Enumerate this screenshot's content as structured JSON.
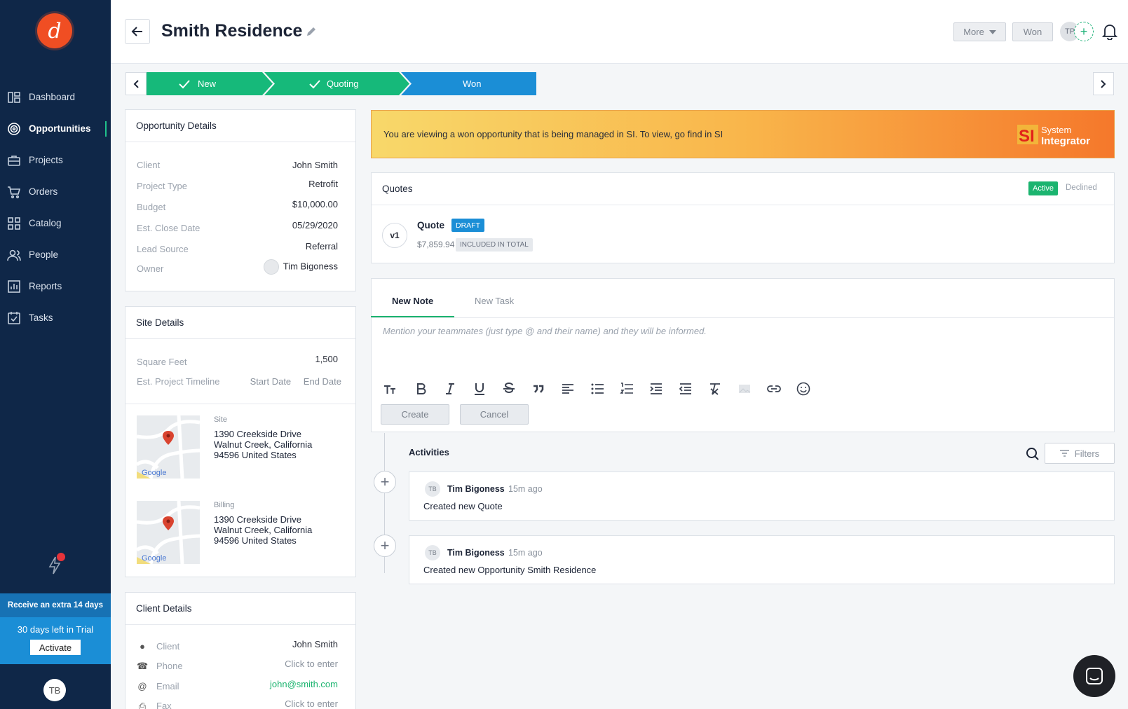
{
  "app": {
    "logo_letter": "d",
    "accent": "#f04e23",
    "sidebar_bg": "#0f2748"
  },
  "sidebar": {
    "items": [
      {
        "label": "Dashboard",
        "icon": "dashboard-icon"
      },
      {
        "label": "Opportunities",
        "icon": "target-icon",
        "active": true
      },
      {
        "label": "Projects",
        "icon": "briefcase-icon"
      },
      {
        "label": "Orders",
        "icon": "cart-icon"
      },
      {
        "label": "Catalog",
        "icon": "catalog-grid-icon"
      },
      {
        "label": "People",
        "icon": "people-icon"
      },
      {
        "label": "Reports",
        "icon": "reports-icon"
      },
      {
        "label": "Tasks",
        "icon": "tasks-icon"
      }
    ],
    "trial": {
      "promo": "Receive an extra 14 days",
      "days_left": "30 days left in Trial",
      "activate": "Activate"
    },
    "user_initials": "TB"
  },
  "header": {
    "title": "Smith Residence",
    "more_label": "More",
    "won_label": "Won",
    "avatar_initials": "TP",
    "add_symbol": "+"
  },
  "stages": [
    {
      "label": "New",
      "done": true,
      "color": "#16b97a"
    },
    {
      "label": "Quoting",
      "done": true,
      "color": "#16b97a"
    },
    {
      "label": "Won",
      "done": false,
      "color": "#1b8ed6"
    }
  ],
  "opportunity_details": {
    "title": "Opportunity Details",
    "rows": [
      {
        "label": "Client",
        "value": "John Smith"
      },
      {
        "label": "Project Type",
        "value": "Retrofit"
      },
      {
        "label": "Budget",
        "value": "$10,000.00"
      },
      {
        "label": "Est. Close Date",
        "value": "05/29/2020"
      },
      {
        "label": "Lead Source",
        "value": "Referral"
      },
      {
        "label": "Owner",
        "value": "Tim Bigoness"
      }
    ]
  },
  "site_details": {
    "title": "Site Details",
    "square_feet_label": "Square Feet",
    "square_feet": "1,500",
    "timeline_label": "Est. Project Timeline",
    "start_placeholder": "Start Date",
    "end_placeholder": "End Date",
    "site": {
      "label": "Site",
      "line1": "1390 Creekside Drive",
      "line2": "Walnut Creek, California",
      "line3": "94596 United States"
    },
    "billing": {
      "label": "Billing",
      "line1": "1390 Creekside Drive",
      "line2": "Walnut Creek, California",
      "line3": "94596 United States"
    },
    "map_brand": "Google"
  },
  "client_details": {
    "title": "Client Details",
    "rows": [
      {
        "label": "Client",
        "value": "John Smith",
        "icon": "person-icon"
      },
      {
        "label": "Phone",
        "value": "Click to enter",
        "icon": "phone-icon"
      },
      {
        "label": "Email",
        "value": "john@smith.com",
        "icon": "at-icon"
      },
      {
        "label": "Fax",
        "value": "Click to enter",
        "icon": "fax-icon"
      }
    ]
  },
  "banner": {
    "text": "You are viewing a won opportunity that is being managed in SI. To view, go find in SI",
    "logo_si": "SI",
    "logo_line1": "System",
    "logo_line2": "Integrator"
  },
  "quotes": {
    "title": "Quotes",
    "active_label": "Active",
    "declined_label": "Declined",
    "items": [
      {
        "version": "v1",
        "name": "Quote",
        "status": "DRAFT",
        "amount": "$7,859.94",
        "tag": "INCLUDED IN TOTAL"
      }
    ]
  },
  "note_editor": {
    "tab_note": "New Note",
    "tab_task": "New Task",
    "placeholder": "Mention your teammates (just type @ and their name) and they will be informed.",
    "create_label": "Create",
    "cancel_label": "Cancel"
  },
  "activities": {
    "title": "Activities",
    "filters_label": "Filters",
    "items": [
      {
        "initials": "TB",
        "name": "Tim Bigoness",
        "time": "15m ago",
        "text": "Created new Quote"
      },
      {
        "initials": "TB",
        "name": "Tim Bigoness",
        "time": "15m ago",
        "text": "Created new Opportunity Smith Residence"
      }
    ]
  }
}
